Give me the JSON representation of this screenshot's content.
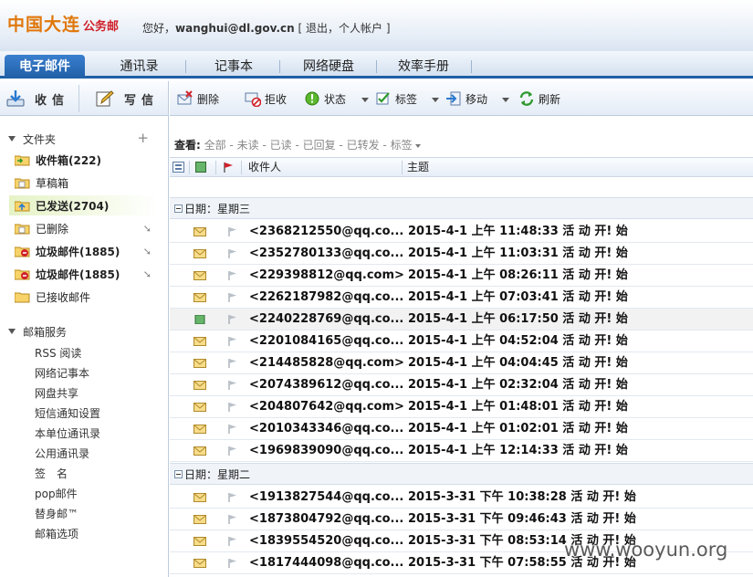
{
  "header": {
    "logo_text": "中国大连",
    "logo_sub": "公务邮",
    "greeting_prefix": "您好，",
    "user_email": "wanghui@dl.gov.cn",
    "bracket_open": " [ ",
    "logout": "退出",
    "comma": "，",
    "account": "个人帐户",
    "bracket_close": " ]"
  },
  "nav": {
    "tabs": [
      {
        "label": "电子邮件"
      },
      {
        "label": "通讯录"
      },
      {
        "label": "记事本"
      },
      {
        "label": "网络硬盘"
      },
      {
        "label": "效率手册"
      }
    ]
  },
  "left_toolbar": {
    "receive": "收信",
    "compose": "写信"
  },
  "toolbar": {
    "delete": "删除",
    "reject": "拒收",
    "status": "状态",
    "tag": "标签",
    "move": "移动",
    "refresh": "刷新"
  },
  "sidebar": {
    "folders_title": "文件夹",
    "folders": [
      {
        "name": "收件箱(222)"
      },
      {
        "name": "草稿箱"
      },
      {
        "name": "已发送(2704)"
      },
      {
        "name": "已删除"
      },
      {
        "name": "垃圾邮件(1885)"
      },
      {
        "name": "垃圾邮件(1885)"
      },
      {
        "name": "已接收邮件"
      }
    ],
    "services_title": "邮箱服务",
    "services": [
      {
        "name": "RSS 阅读"
      },
      {
        "name": "网络记事本"
      },
      {
        "name": "网盘共享"
      },
      {
        "name": "短信通知设置"
      },
      {
        "name": "本单位通讯录"
      },
      {
        "name": "公用通讯录"
      },
      {
        "name": "签　名"
      },
      {
        "name": "pop邮件"
      },
      {
        "name": "替身邮™"
      },
      {
        "name": "邮箱选项"
      }
    ]
  },
  "filter": {
    "label": "查看:",
    "options": [
      {
        "label": "全部"
      },
      {
        "label": "未读"
      },
      {
        "label": "已读"
      },
      {
        "label": "已回复"
      },
      {
        "label": "已转发"
      },
      {
        "label": "标签"
      }
    ],
    "sep": " - "
  },
  "list": {
    "col_recipient": "收件人",
    "col_subject": "主题",
    "groups": [
      {
        "label": "日期：星期三",
        "rows": [
          {
            "recipient": "<2368212550@qq.co...",
            "subject": "2015-4-1 上午 11:48:33 活 动 开! 始"
          },
          {
            "recipient": "<2352780133@qq.co...",
            "subject": "2015-4-1 上午 11:03:31 活 动 开! 始"
          },
          {
            "recipient": "<229398812@qq.com>",
            "subject": "2015-4-1 上午 08:26:11 活 动 开! 始"
          },
          {
            "recipient": "<2262187982@qq.co...",
            "subject": "2015-4-1 上午 07:03:41 活 动 开! 始"
          },
          {
            "recipient": "<2240228769@qq.co...",
            "subject": "2015-4-1 上午 06:17:50 活 动 开! 始"
          },
          {
            "recipient": "<2201084165@qq.co...",
            "subject": "2015-4-1 上午 04:52:04 活 动 开! 始"
          },
          {
            "recipient": "<214485828@qq.com>",
            "subject": "2015-4-1 上午 04:04:45 活 动 开! 始"
          },
          {
            "recipient": "<2074389612@qq.co...",
            "subject": "2015-4-1 上午 02:32:04 活 动 开! 始"
          },
          {
            "recipient": "<204807642@qq.com>",
            "subject": "2015-4-1 上午 01:48:01 活 动 开! 始"
          },
          {
            "recipient": "<2010343346@qq.co...",
            "subject": "2015-4-1 上午 01:02:01 活 动 开! 始"
          },
          {
            "recipient": "<1969839090@qq.co...",
            "subject": "2015-4-1 上午 12:14:33 活 动 开! 始"
          }
        ]
      },
      {
        "label": "日期：星期二",
        "rows": [
          {
            "recipient": "<1913827544@qq.co...",
            "subject": "2015-3-31 下午 10:38:28 活 动 开! 始"
          },
          {
            "recipient": "<1873804792@qq.co...",
            "subject": "2015-3-31 下午 09:46:43 活 动 开! 始"
          },
          {
            "recipient": "<1839554520@qq.co...",
            "subject": "2015-3-31 下午 08:53:14 活 动 开! 始"
          },
          {
            "recipient": "<1817444098@qq.co...",
            "subject": "2015-3-31 下午 07:58:55 活 动 开! 始"
          }
        ]
      }
    ]
  },
  "watermark": "www.wooyun.org",
  "colors": {
    "brand_orange": "#e0780c",
    "nav_active": "#1f5fa6",
    "sent_highlight": "#e5f3c6"
  }
}
